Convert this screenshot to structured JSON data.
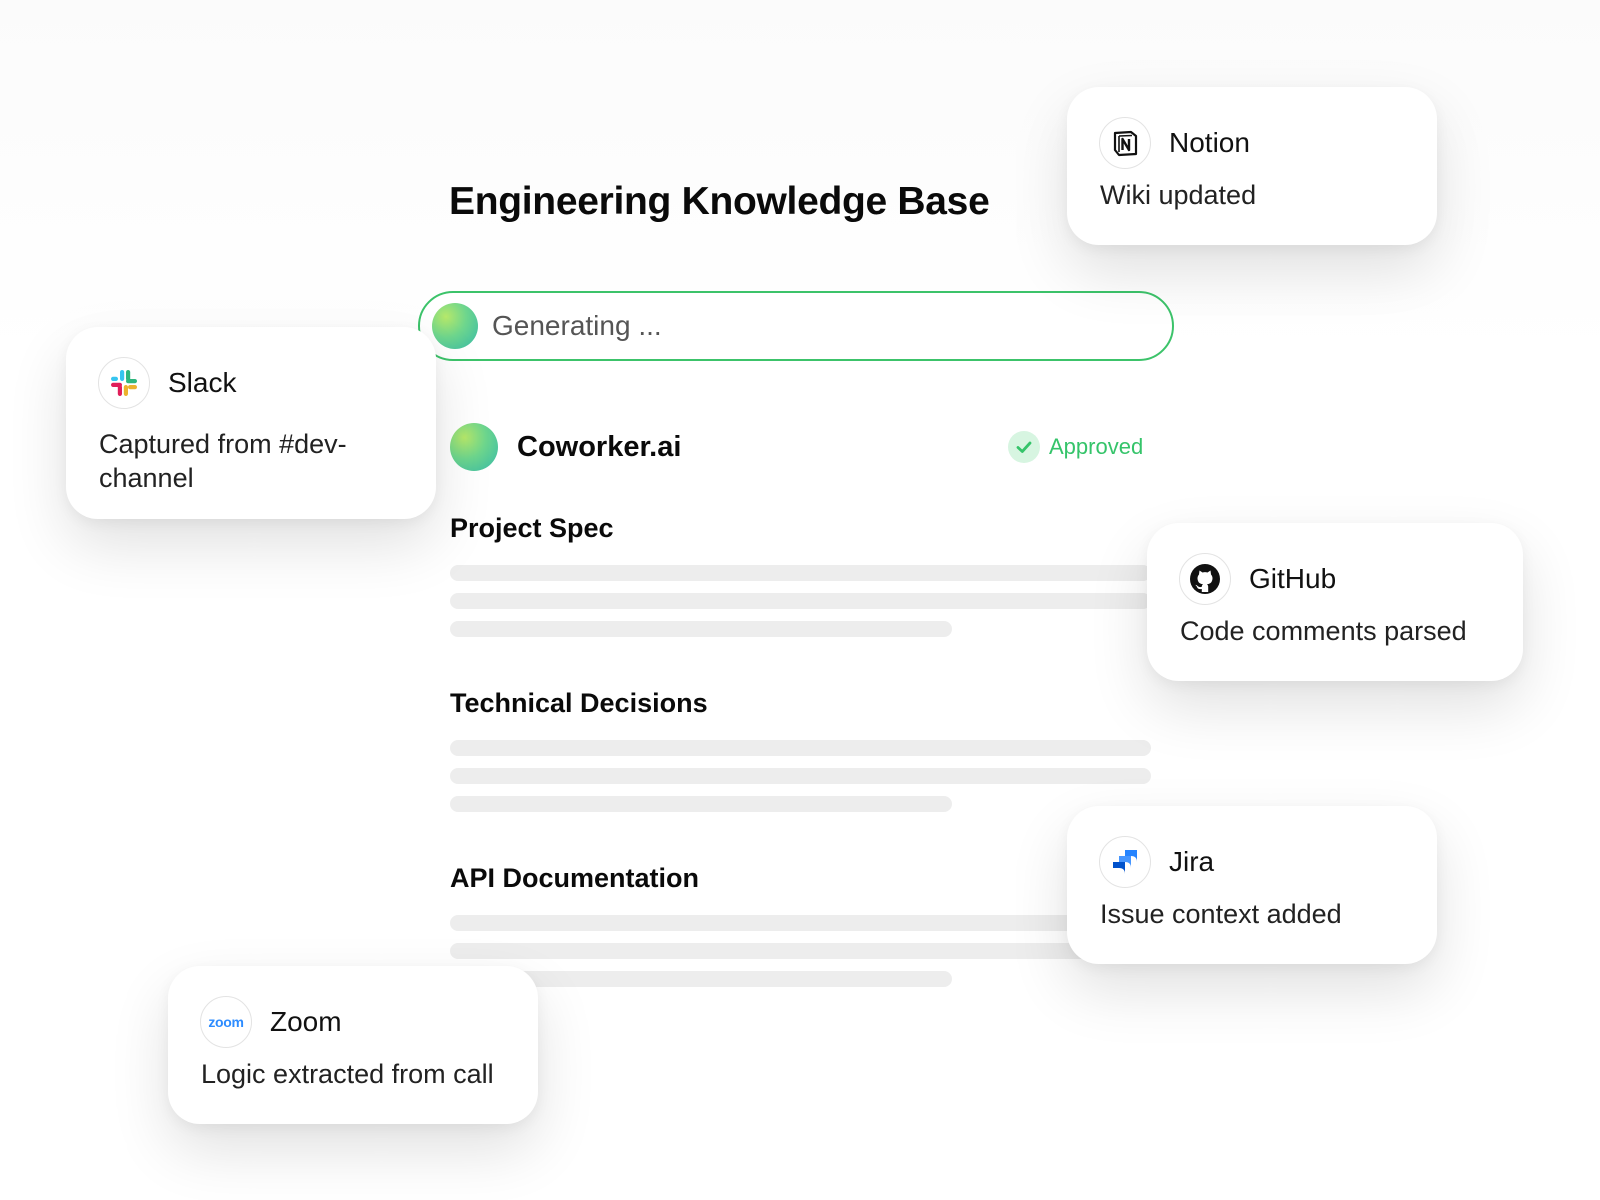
{
  "page": {
    "title": "Engineering Knowledge Base"
  },
  "generator": {
    "status_text": "Generating ..."
  },
  "document": {
    "author": "Coworker.ai",
    "status": "Approved",
    "status_color": "#35c46a",
    "sections": [
      {
        "title": "Project Spec"
      },
      {
        "title": "Technical Decisions"
      },
      {
        "title": "API Documentation"
      }
    ]
  },
  "integrations": [
    {
      "name": "Notion",
      "text": "Wiki updated",
      "icon": "notion-icon"
    },
    {
      "name": "Slack",
      "text": "Captured from #dev-channel",
      "icon": "slack-icon"
    },
    {
      "name": "GitHub",
      "text": "Code comments parsed",
      "icon": "github-icon"
    },
    {
      "name": "Jira",
      "text": "Issue context added",
      "icon": "jira-icon"
    },
    {
      "name": "Zoom",
      "text": "Logic extracted from call",
      "icon": "zoom-icon",
      "icon_text": "zoom"
    }
  ],
  "colors": {
    "accent_green": "#3cc36a",
    "placeholder_line": "#ededed"
  }
}
